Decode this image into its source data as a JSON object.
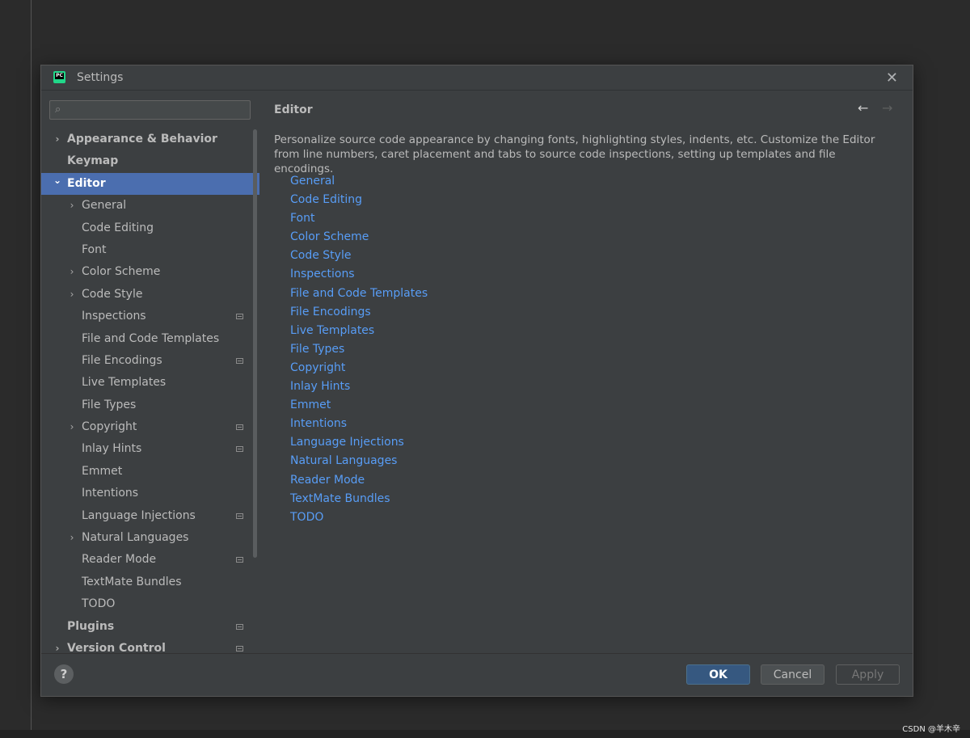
{
  "dialog": {
    "title": "Settings",
    "app_icon_text": "PC"
  },
  "search": {
    "placeholder": "",
    "value": ""
  },
  "sidebar": {
    "items": [
      {
        "label": "Appearance & Behavior",
        "level": 0,
        "expandable": true,
        "expanded": false,
        "badge": false,
        "selected": false
      },
      {
        "label": "Keymap",
        "level": 0,
        "expandable": false,
        "expanded": false,
        "badge": false,
        "selected": false
      },
      {
        "label": "Editor",
        "level": 0,
        "expandable": true,
        "expanded": true,
        "badge": false,
        "selected": true
      },
      {
        "label": "General",
        "level": 1,
        "expandable": true,
        "expanded": false,
        "badge": false,
        "selected": false
      },
      {
        "label": "Code Editing",
        "level": 1,
        "expandable": false,
        "expanded": false,
        "badge": false,
        "selected": false
      },
      {
        "label": "Font",
        "level": 1,
        "expandable": false,
        "expanded": false,
        "badge": false,
        "selected": false
      },
      {
        "label": "Color Scheme",
        "level": 1,
        "expandable": true,
        "expanded": false,
        "badge": false,
        "selected": false
      },
      {
        "label": "Code Style",
        "level": 1,
        "expandable": true,
        "expanded": false,
        "badge": false,
        "selected": false
      },
      {
        "label": "Inspections",
        "level": 1,
        "expandable": false,
        "expanded": false,
        "badge": true,
        "selected": false
      },
      {
        "label": "File and Code Templates",
        "level": 1,
        "expandable": false,
        "expanded": false,
        "badge": false,
        "selected": false
      },
      {
        "label": "File Encodings",
        "level": 1,
        "expandable": false,
        "expanded": false,
        "badge": true,
        "selected": false
      },
      {
        "label": "Live Templates",
        "level": 1,
        "expandable": false,
        "expanded": false,
        "badge": false,
        "selected": false
      },
      {
        "label": "File Types",
        "level": 1,
        "expandable": false,
        "expanded": false,
        "badge": false,
        "selected": false
      },
      {
        "label": "Copyright",
        "level": 1,
        "expandable": true,
        "expanded": false,
        "badge": true,
        "selected": false
      },
      {
        "label": "Inlay Hints",
        "level": 1,
        "expandable": false,
        "expanded": false,
        "badge": true,
        "selected": false
      },
      {
        "label": "Emmet",
        "level": 1,
        "expandable": false,
        "expanded": false,
        "badge": false,
        "selected": false
      },
      {
        "label": "Intentions",
        "level": 1,
        "expandable": false,
        "expanded": false,
        "badge": false,
        "selected": false
      },
      {
        "label": "Language Injections",
        "level": 1,
        "expandable": false,
        "expanded": false,
        "badge": true,
        "selected": false
      },
      {
        "label": "Natural Languages",
        "level": 1,
        "expandable": true,
        "expanded": false,
        "badge": false,
        "selected": false
      },
      {
        "label": "Reader Mode",
        "level": 1,
        "expandable": false,
        "expanded": false,
        "badge": true,
        "selected": false
      },
      {
        "label": "TextMate Bundles",
        "level": 1,
        "expandable": false,
        "expanded": false,
        "badge": false,
        "selected": false
      },
      {
        "label": "TODO",
        "level": 1,
        "expandable": false,
        "expanded": false,
        "badge": false,
        "selected": false
      },
      {
        "label": "Plugins",
        "level": 0,
        "expandable": false,
        "expanded": false,
        "badge": true,
        "selected": false
      },
      {
        "label": "Version Control",
        "level": 0,
        "expandable": true,
        "expanded": false,
        "badge": true,
        "selected": false
      }
    ]
  },
  "content": {
    "breadcrumb": "Editor",
    "description": "Personalize source code appearance by changing fonts, highlighting styles, indents, etc. Customize the Editor from line numbers, caret placement and tabs to source code inspections, setting up templates and file encodings.",
    "links": [
      "General",
      "Code Editing",
      "Font",
      "Color Scheme",
      "Code Style",
      "Inspections",
      "File and Code Templates",
      "File Encodings",
      "Live Templates",
      "File Types",
      "Copyright",
      "Inlay Hints",
      "Emmet",
      "Intentions",
      "Language Injections",
      "Natural Languages",
      "Reader Mode",
      "TextMate Bundles",
      "TODO"
    ]
  },
  "footer": {
    "help_label": "?",
    "ok_label": "OK",
    "cancel_label": "Cancel",
    "apply_label": "Apply"
  },
  "watermark": "CSDN @羊木辛",
  "colors": {
    "selection": "#4b6eaf",
    "link": "#589df6",
    "dialog_bg": "#3c3f41",
    "ok_button": "#365880"
  }
}
